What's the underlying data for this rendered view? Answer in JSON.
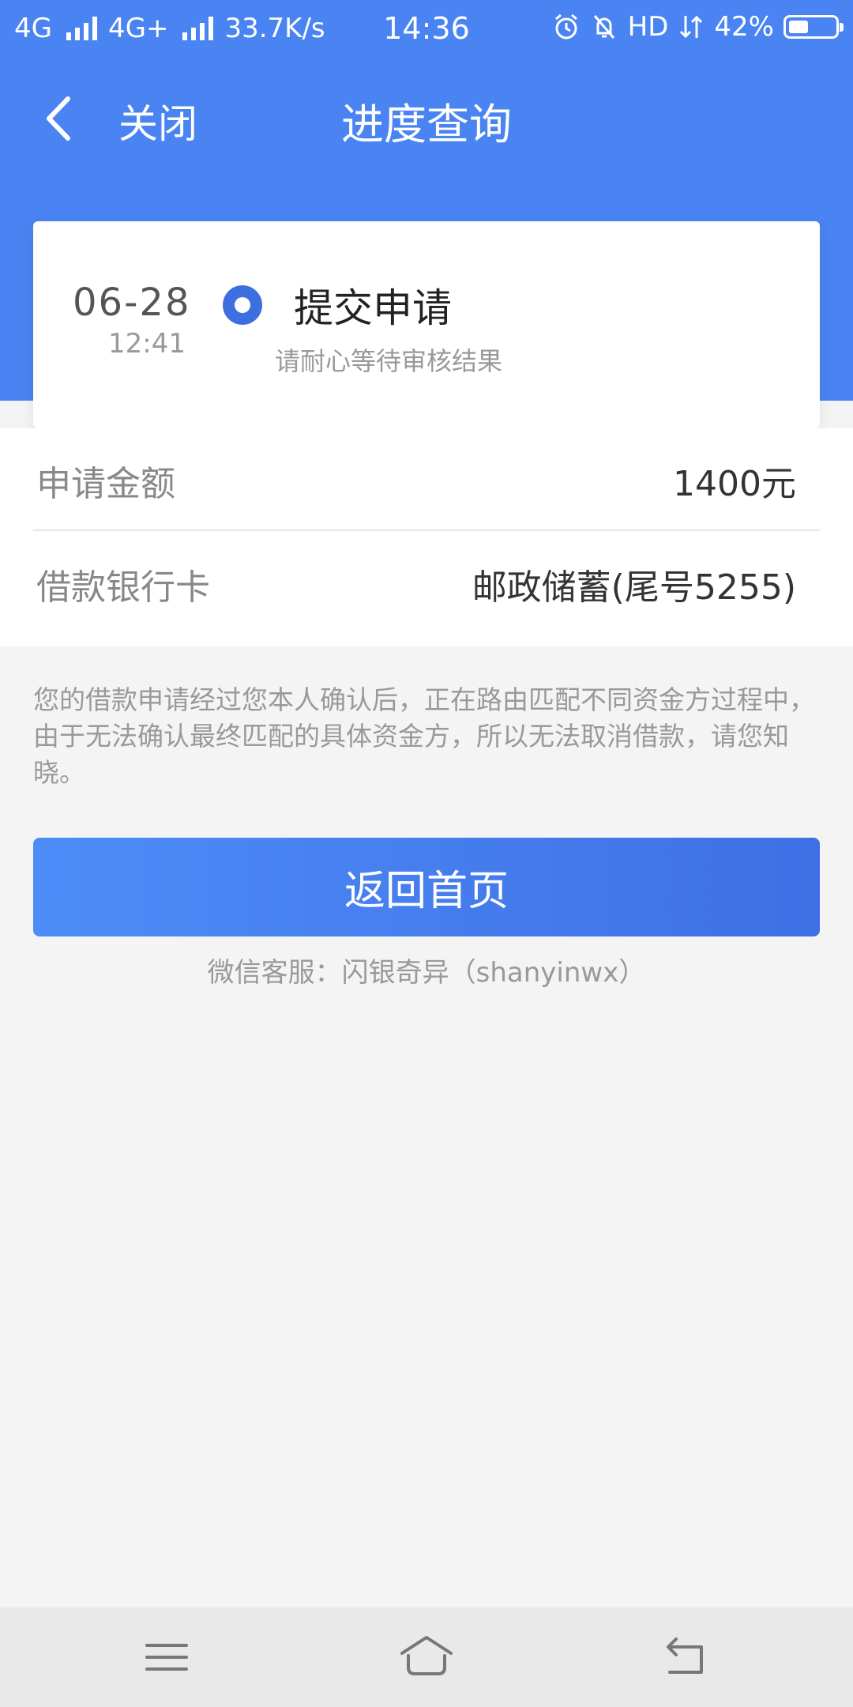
{
  "statusbar": {
    "sim1": "4G",
    "sim2": "4G+",
    "speed": "33.7K/s",
    "time": "14:36",
    "hd": "HD",
    "battery": "42%",
    "battery_level": 0.42
  },
  "navbar": {
    "close_label": "关闭",
    "title": "进度查询"
  },
  "timeline": {
    "date": "06-28",
    "time": "12:41",
    "title": "提交申请",
    "subtitle": "请耐心等待审核结果"
  },
  "details": {
    "amount_label": "申请金额",
    "amount_value": "1400元",
    "card_label": "借款银行卡",
    "card_value": "邮政储蓄(尾号5255)"
  },
  "notice": "您的借款申请经过您本人确认后，正在路由匹配不同资金方过程中，由于无法确认最终匹配的具体资金方，所以无法取消借款，请您知晓。",
  "home_button": "返回首页",
  "service": "微信客服：闪银奇异（shanyinwx）",
  "colors": {
    "primary": "#4a84f2",
    "button_start": "#4d8df8",
    "button_end": "#3f6fe4"
  }
}
